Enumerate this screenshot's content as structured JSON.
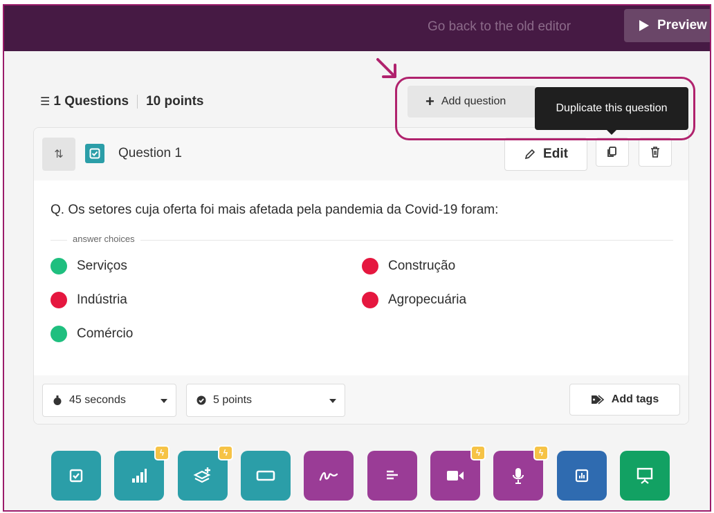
{
  "topbar": {
    "old_editor_label": "Go back to the old editor",
    "preview_label": "Preview"
  },
  "summary": {
    "questions_label": "1 Questions",
    "points_label": "10 points"
  },
  "actions": {
    "add_question_label": "Add question",
    "tooltip_text": "Duplicate this question"
  },
  "question": {
    "title": "Question 1",
    "edit_label": "Edit",
    "text": "Q. Os setores cuja oferta foi mais afetada pela pandemia da Covid-19 foram:",
    "answer_choices_label": "answer choices",
    "choices": [
      {
        "label": "Serviços",
        "correct": true
      },
      {
        "label": "Construção",
        "correct": false
      },
      {
        "label": "Indústria",
        "correct": false
      },
      {
        "label": "Agropecuária",
        "correct": false
      },
      {
        "label": "Comércio",
        "correct": true
      }
    ],
    "time_value": "45 seconds",
    "points_value": "5 points",
    "add_tags_label": "Add tags"
  },
  "colors": {
    "topbar": "#461a44",
    "correct": "#1fbf7f",
    "incorrect": "#e5173f",
    "highlight": "#b0226d",
    "teal": "#2b9ea8",
    "purple": "#9a3c96",
    "blue": "#2f6bb0",
    "green": "#12a163",
    "bolt": "#f6c346"
  },
  "question_types": [
    {
      "icon": "checkbox-icon",
      "color": "#2b9ea8",
      "premium": false
    },
    {
      "icon": "bar-chart-icon",
      "color": "#2b9ea8",
      "premium": true
    },
    {
      "icon": "layers-add-icon",
      "color": "#2b9ea8",
      "premium": true
    },
    {
      "icon": "rectangle-icon",
      "color": "#2b9ea8",
      "premium": false
    },
    {
      "icon": "draw-icon",
      "color": "#9a3c96",
      "premium": false
    },
    {
      "icon": "text-lines-icon",
      "color": "#9a3c96",
      "premium": false
    },
    {
      "icon": "video-icon",
      "color": "#9a3c96",
      "premium": true
    },
    {
      "icon": "microphone-icon",
      "color": "#9a3c96",
      "premium": true
    },
    {
      "icon": "poll-icon",
      "color": "#2f6bb0",
      "premium": false
    },
    {
      "icon": "presentation-icon",
      "color": "#12a163",
      "premium": false
    }
  ]
}
